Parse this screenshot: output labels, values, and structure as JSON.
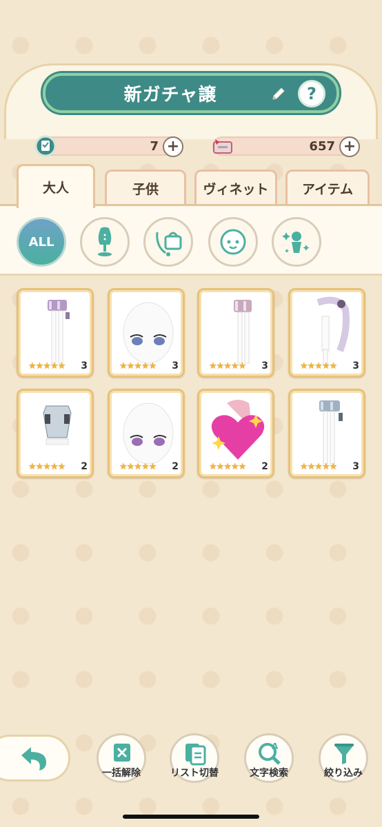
{
  "header": {
    "title": "新ガチャ譲"
  },
  "currency": [
    {
      "icon": "ticket-icon",
      "value": "7"
    },
    {
      "icon": "gem-card-icon",
      "value": "657"
    }
  ],
  "tabs": [
    {
      "label": "大人",
      "active": true
    },
    {
      "label": "子供",
      "active": false
    },
    {
      "label": "ヴィネット",
      "active": false
    },
    {
      "label": "アイテム",
      "active": false
    }
  ],
  "filters": [
    {
      "label": "ALL",
      "icon": "all-icon"
    },
    {
      "label": "",
      "icon": "mannequin-icon"
    },
    {
      "label": "",
      "icon": "handbag-icon"
    },
    {
      "label": "",
      "icon": "face-icon"
    },
    {
      "label": "",
      "icon": "sparkle-figure-icon"
    }
  ],
  "items": [
    {
      "kind": "legs-skirt",
      "stars": "★★★★★",
      "count": "3"
    },
    {
      "kind": "face-blue-eyes",
      "stars": "★★★★★",
      "count": "3"
    },
    {
      "kind": "legs-skirt",
      "stars": "★★★★★",
      "count": "3"
    },
    {
      "kind": "hair-body",
      "stars": "★★★★★",
      "count": "3"
    },
    {
      "kind": "vest-top",
      "stars": "★★★★★",
      "count": "2"
    },
    {
      "kind": "face-purple-eyes",
      "stars": "★★★★★",
      "count": "2"
    },
    {
      "kind": "heart-sparkle",
      "stars": "★★★★★",
      "count": "2"
    },
    {
      "kind": "legs-skirt-blue",
      "stars": "★★★★★",
      "count": "3"
    }
  ],
  "toolbar": {
    "back_icon": "back-arrow-icon",
    "buttons": [
      {
        "label": "一括解除",
        "icon": "deselect-icon"
      },
      {
        "label": "リスト切替",
        "icon": "list-switch-icon"
      },
      {
        "label": "文字検索",
        "icon": "text-search-icon"
      },
      {
        "label": "絞り込み",
        "icon": "filter-funnel-icon"
      }
    ]
  },
  "colors": {
    "accent_teal": "#3e8a86",
    "gold_border": "#e8c177",
    "star": "#f0b53c"
  }
}
